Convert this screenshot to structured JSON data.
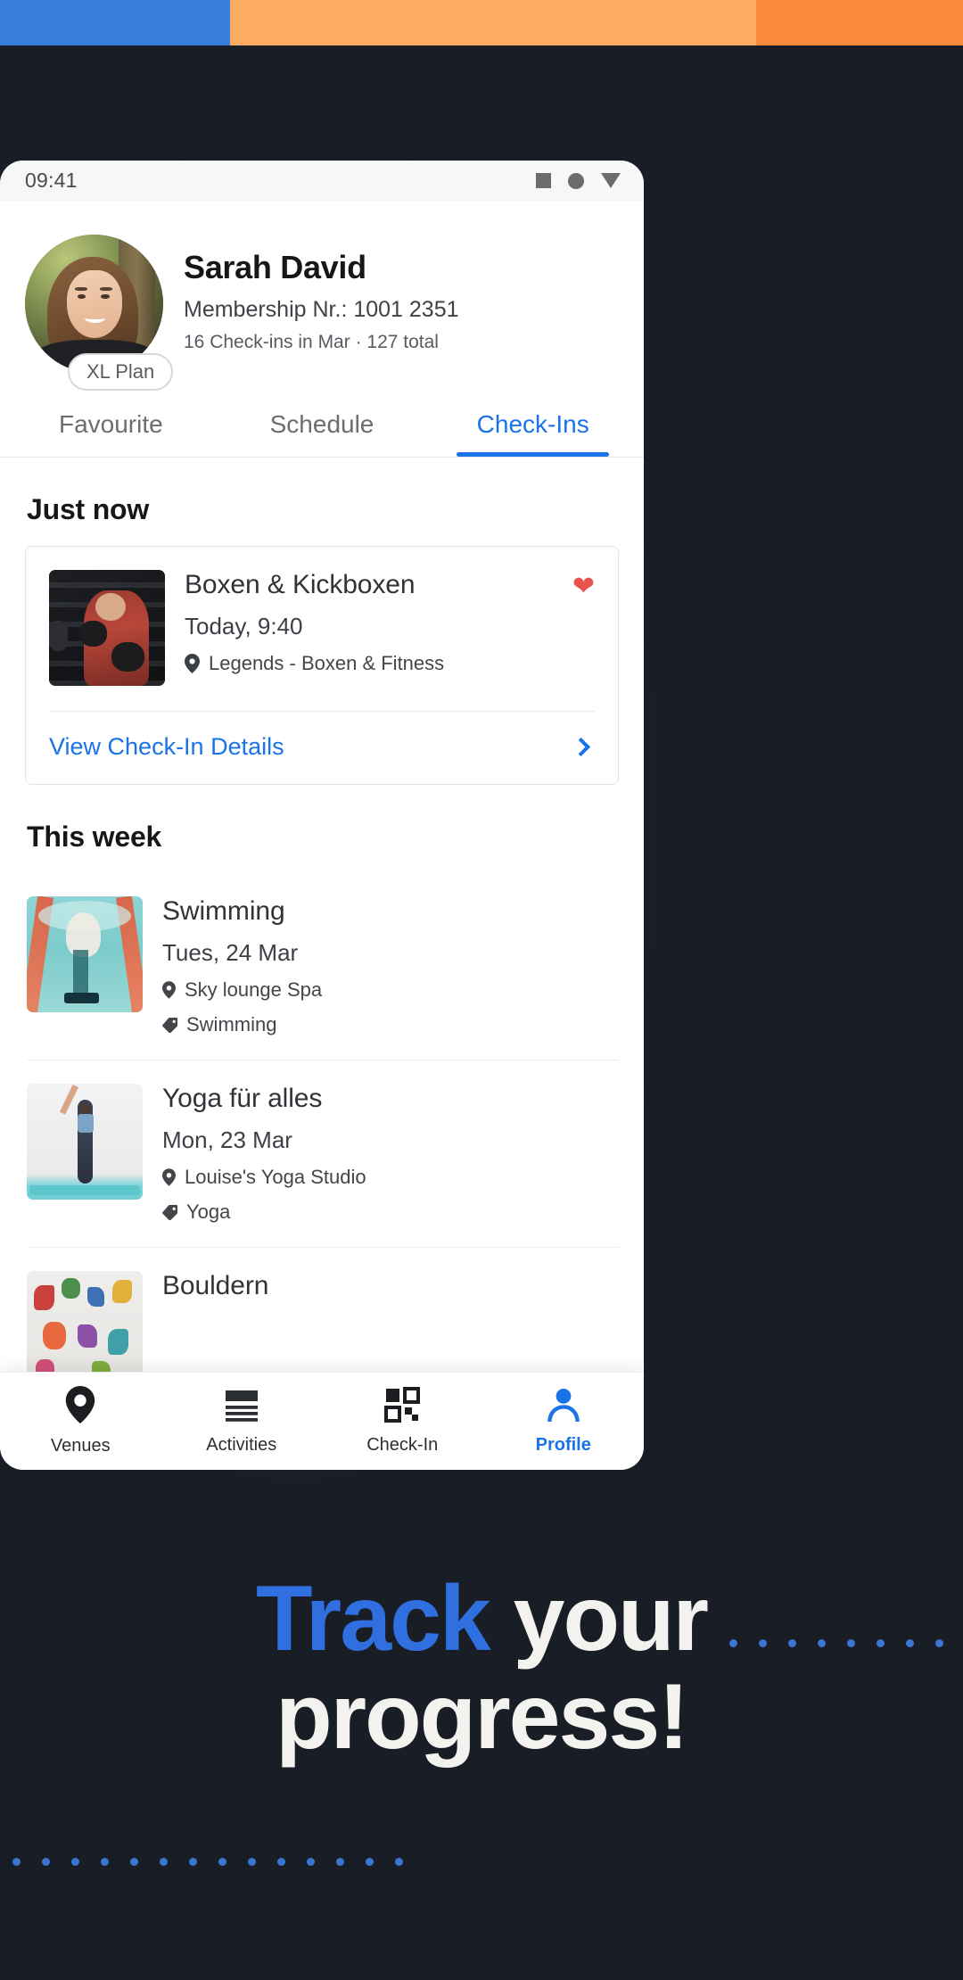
{
  "decor": {
    "topbar": [
      {
        "name": "segment-blue",
        "color": "#3b7ddd"
      },
      {
        "name": "segment-orange",
        "color": "#fbab62"
      },
      {
        "name": "segment-orange-dark",
        "color": "#fa8b3c"
      }
    ],
    "background_color": "#191d26",
    "dot_color": "#3b76d4",
    "dots_right_count": 11,
    "dots_left_count": 14
  },
  "phone": {
    "statusbar": {
      "clock": "09:41",
      "icons": [
        "square-icon",
        "circle-icon",
        "triangle-down-icon"
      ]
    },
    "profile": {
      "name": "Sarah David",
      "membership": "Membership Nr.: 1001 2351",
      "stats": "16 Check-ins in Mar · 127 total",
      "plan_badge": "XL Plan",
      "avatar_alt": "avatar"
    },
    "tabs": [
      {
        "label": "Favourite",
        "active": false
      },
      {
        "label": "Schedule",
        "active": false
      },
      {
        "label": "Check-Ins",
        "active": true
      }
    ],
    "sections": [
      {
        "title": "Just now",
        "card": {
          "title": "Boxen & Kickboxen",
          "time": "Today, 9:40",
          "venue": "Legends - Boxen & Fitness",
          "favourite": true,
          "action_label": "View Check-In Details"
        }
      },
      {
        "title": "This week",
        "items": [
          {
            "title": "Swimming",
            "date": "Tues, 24 Mar",
            "venue": "Sky lounge Spa",
            "tag": "Swimming"
          },
          {
            "title": "Yoga für alles",
            "date": "Mon, 23 Mar",
            "venue": "Louise's Yoga Studio",
            "tag": "Yoga"
          },
          {
            "title": "Bouldern",
            "date": "",
            "venue": "",
            "tag": ""
          }
        ]
      }
    ],
    "bottomnav": [
      {
        "label": "Venues",
        "icon": "location-pin-icon",
        "active": false
      },
      {
        "label": "Activities",
        "icon": "list-icon",
        "active": false
      },
      {
        "label": "Check-In",
        "icon": "qr-code-icon",
        "active": false
      },
      {
        "label": "Profile",
        "icon": "person-icon",
        "active": true
      }
    ]
  },
  "headline": {
    "accent_word": "Track",
    "rest_line1": " your",
    "line2": "progress!",
    "accent_color": "#2f6fe0",
    "text_color": "#f4f2ee"
  }
}
